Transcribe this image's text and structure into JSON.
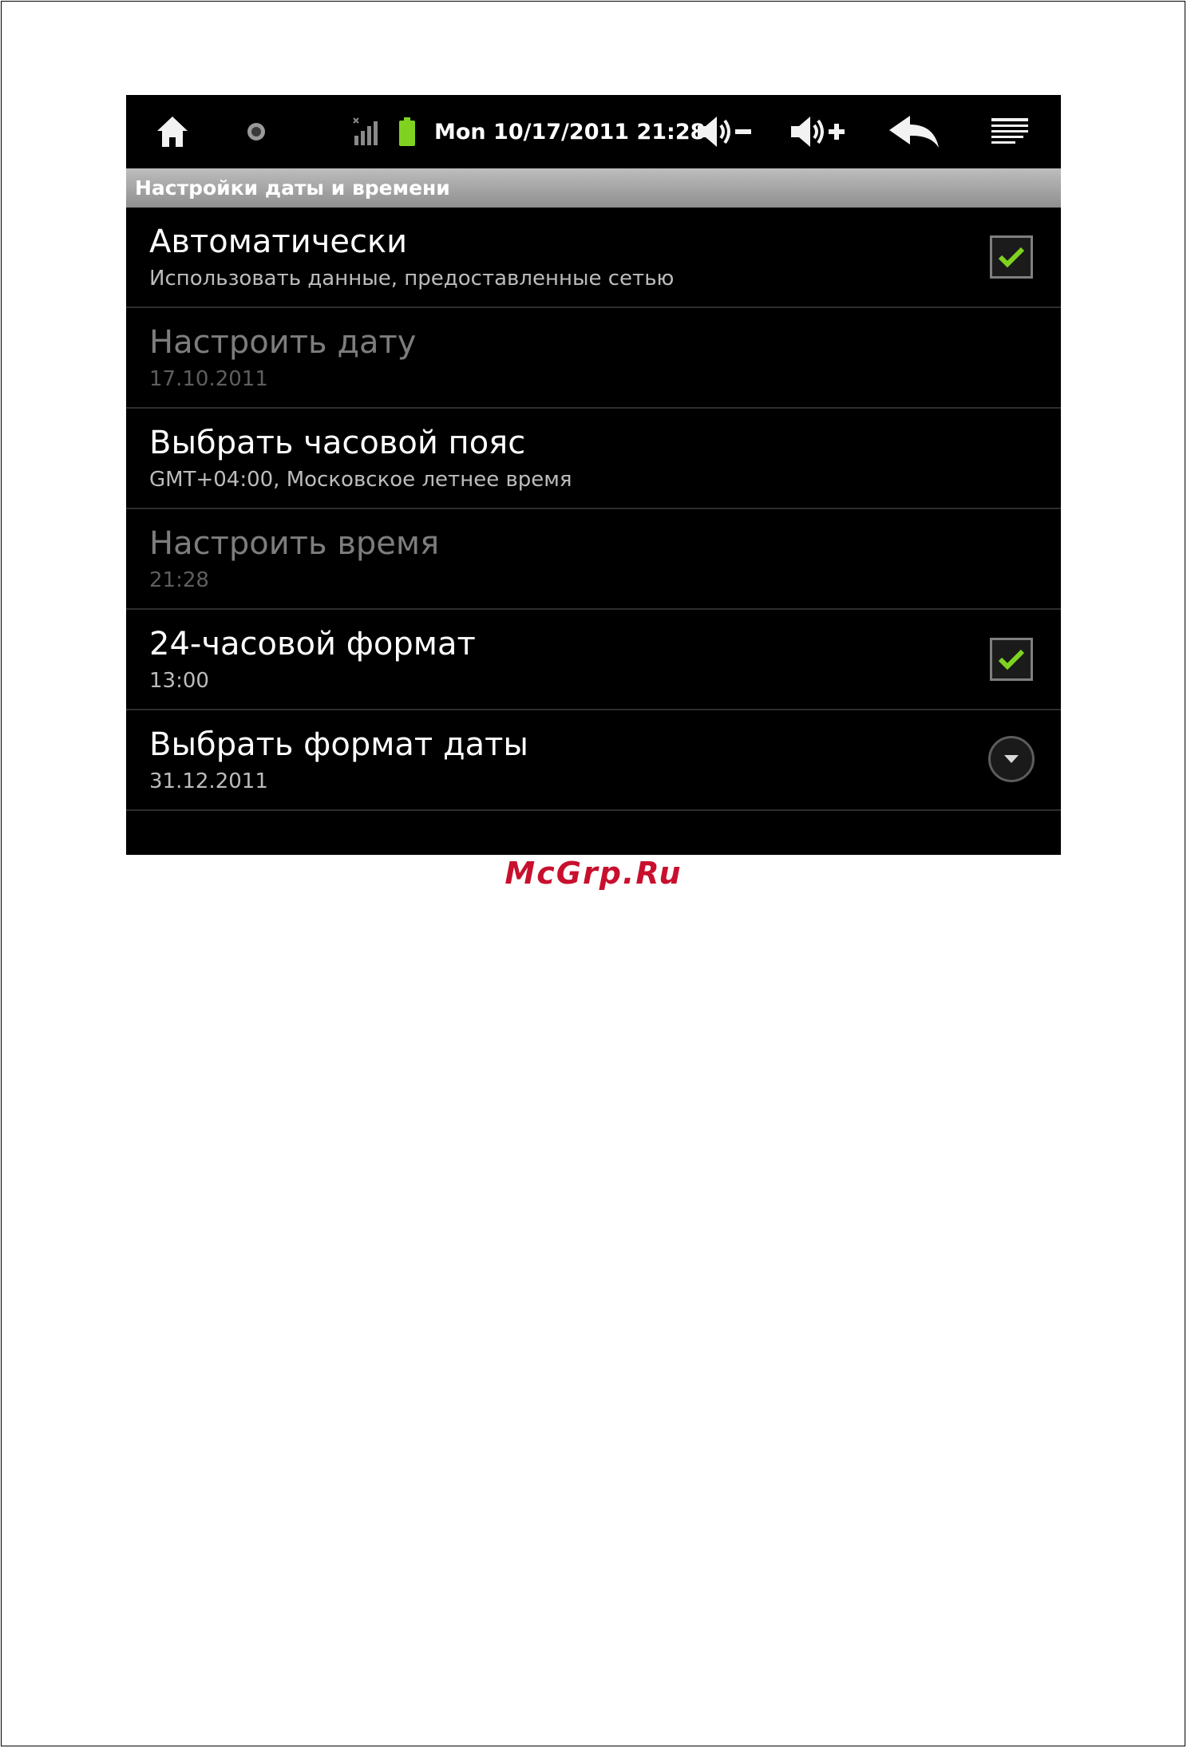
{
  "status_bar": {
    "datetime": "Mon 10/17/2011 21:28",
    "icons": [
      "home-icon",
      "notification-dot-icon",
      "signal-icon",
      "battery-icon",
      "volume-down-icon",
      "volume-up-icon",
      "back-icon",
      "menu-icon"
    ]
  },
  "section_header": "Настройки даты и времени",
  "settings": [
    {
      "title": "Автоматически",
      "summary": "Использовать данные, предоставленные сетью",
      "control": "checkbox",
      "checked": true,
      "enabled": true
    },
    {
      "title": "Настроить дату",
      "summary": "17.10.2011",
      "control": "none",
      "enabled": false
    },
    {
      "title": "Выбрать часовой пояс",
      "summary": "GMT+04:00, Московское летнее время",
      "control": "none",
      "enabled": true
    },
    {
      "title": "Настроить время",
      "summary": "21:28",
      "control": "none",
      "enabled": false
    },
    {
      "title": "24-часовой формат",
      "summary": "13:00",
      "control": "checkbox",
      "checked": true,
      "enabled": true
    },
    {
      "title": "Выбрать формат даты",
      "summary": "31.12.2011",
      "control": "dropdown",
      "enabled": true
    }
  ],
  "watermark": "McGrp.Ru",
  "colors": {
    "check": "#7fd320",
    "battery": "#7fd320",
    "watermark": "#c8102e"
  }
}
